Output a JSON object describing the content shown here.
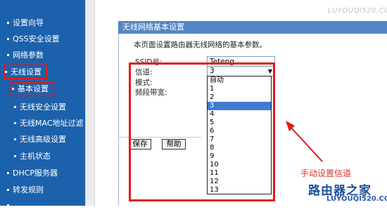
{
  "sidebar": {
    "items": [
      {
        "label": "设置向导"
      },
      {
        "label": "QSS安全设置"
      },
      {
        "label": "网络参数"
      },
      {
        "label": "无线设置"
      },
      {
        "label": "基本设置"
      },
      {
        "label": "无线安全设置"
      },
      {
        "label": "无线MAC地址过滤"
      },
      {
        "label": "无线高级设置"
      },
      {
        "label": "主机状态"
      },
      {
        "label": "DHCP服务器"
      },
      {
        "label": "转发规则"
      }
    ]
  },
  "panel": {
    "title": "无线网络基本设置",
    "description": "本页面设置路由器无线网络的基本参数。",
    "ssid_label": "SSID号:",
    "ssid_value": "Teteng",
    "channel_label": "信道:",
    "channel_value": "3",
    "mode_label": "模式:",
    "bandwidth_label": "频段带宽:"
  },
  "channel_options": [
    "自动",
    "1",
    "2",
    "3",
    "4",
    "5",
    "6",
    "7",
    "8",
    "9",
    "10",
    "11",
    "12",
    "13"
  ],
  "buttons": {
    "save": "保存",
    "help": "帮助"
  },
  "annotation": {
    "text": "手动设置信道"
  },
  "watermark": {
    "main": "路由器之家",
    "url": "LUYOUQI520.COM",
    "top": "LUYOUQI520.COM"
  },
  "colors": {
    "sidebar": "#1c61ac",
    "header": "#5386c4",
    "highlight": "#e21a1a",
    "selected_option": "#3d7bd0"
  }
}
